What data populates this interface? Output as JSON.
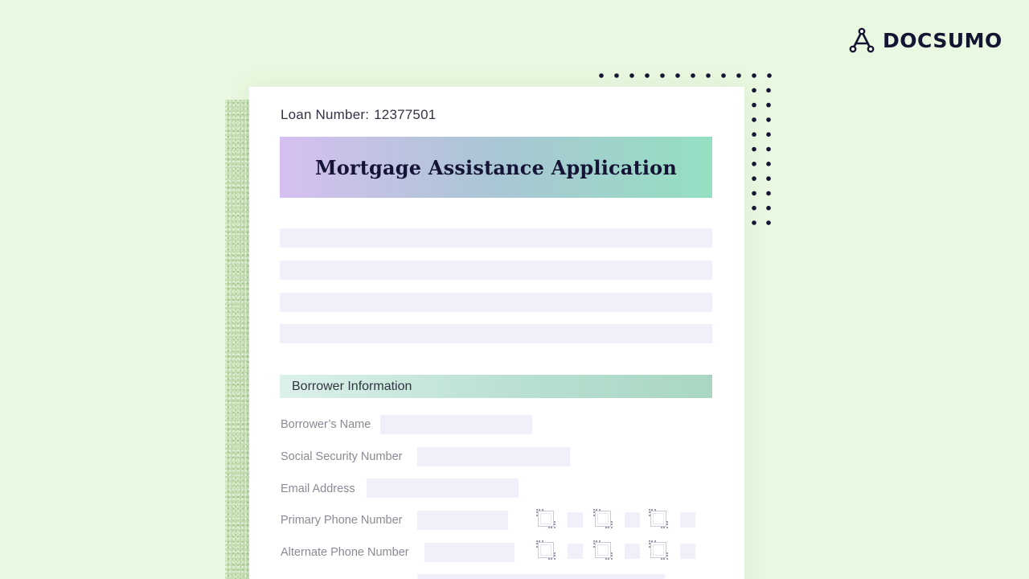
{
  "brand": {
    "name": "DOCSUMO",
    "logo_icon": "docsumo-logo-icon",
    "color": "#141433"
  },
  "document": {
    "loan_number_label": "Loan Number:",
    "loan_number_value": "12377501",
    "title": "Mortgage Assistance Application",
    "sections": [
      {
        "heading": "Borrower Information",
        "fields": [
          {
            "label": "Borrower’s Name"
          },
          {
            "label": "Social Security Number"
          },
          {
            "label": "Email Address"
          },
          {
            "label": "Primary Phone Number"
          },
          {
            "label": "Alternate Phone Number"
          }
        ]
      }
    ]
  },
  "colors": {
    "background": "#e9f8e0",
    "title_gradient_start": "#d6bff0",
    "title_gradient_end": "#95dfc2",
    "section_gradient_start": "#dcf1ea",
    "section_gradient_end": "#a9d6c3",
    "field_fill": "#f0f0fa"
  }
}
